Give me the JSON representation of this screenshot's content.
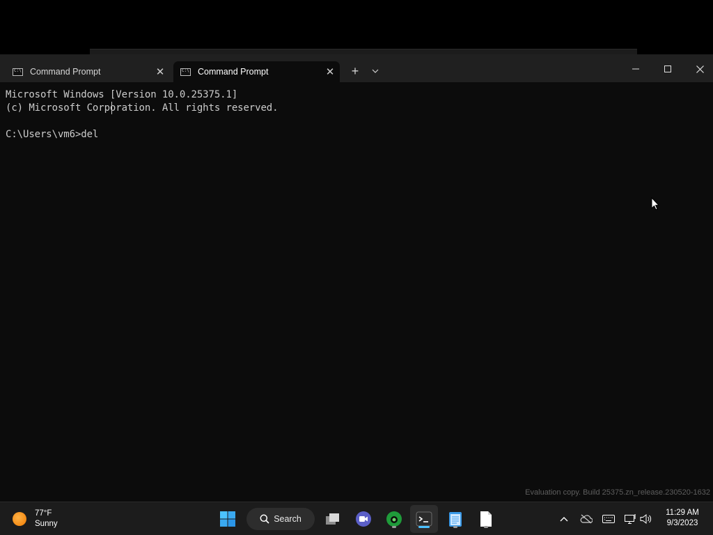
{
  "window": {
    "tabs": [
      {
        "label": "Command Prompt",
        "active": false
      },
      {
        "label": "Command Prompt",
        "active": true
      }
    ],
    "new_tab": "+"
  },
  "console": {
    "lines": [
      "Microsoft Windows [Version 10.0.25375.1]",
      "(c) Microsoft Corporation. All rights reserved.",
      "",
      "C:\\Users\\vm6>del "
    ]
  },
  "watermark": "Evaluation copy. Build 25375.zn_release.230520-1632",
  "taskbar": {
    "weather": {
      "temp": "77°F",
      "condition": "Sunny"
    },
    "search_label": "Search",
    "apps": [
      "start-icon",
      "task-view-icon",
      "meet-icon",
      "edge-dev-icon",
      "terminal-icon",
      "notepad-icon",
      "file-icon"
    ],
    "tray": [
      "chevron-up-icon",
      "onedrive-icon",
      "keyboard-icon",
      "network-icon",
      "volume-icon"
    ],
    "clock": {
      "time": "11:29 AM",
      "date": "9/3/2023"
    }
  },
  "colors": {
    "console_bg": "#0c0c0c",
    "titlebar_bg": "#202020",
    "console_text": "#cccccc",
    "taskbar_bg": "#1c1c1c",
    "accent": "#4cc2ff"
  }
}
